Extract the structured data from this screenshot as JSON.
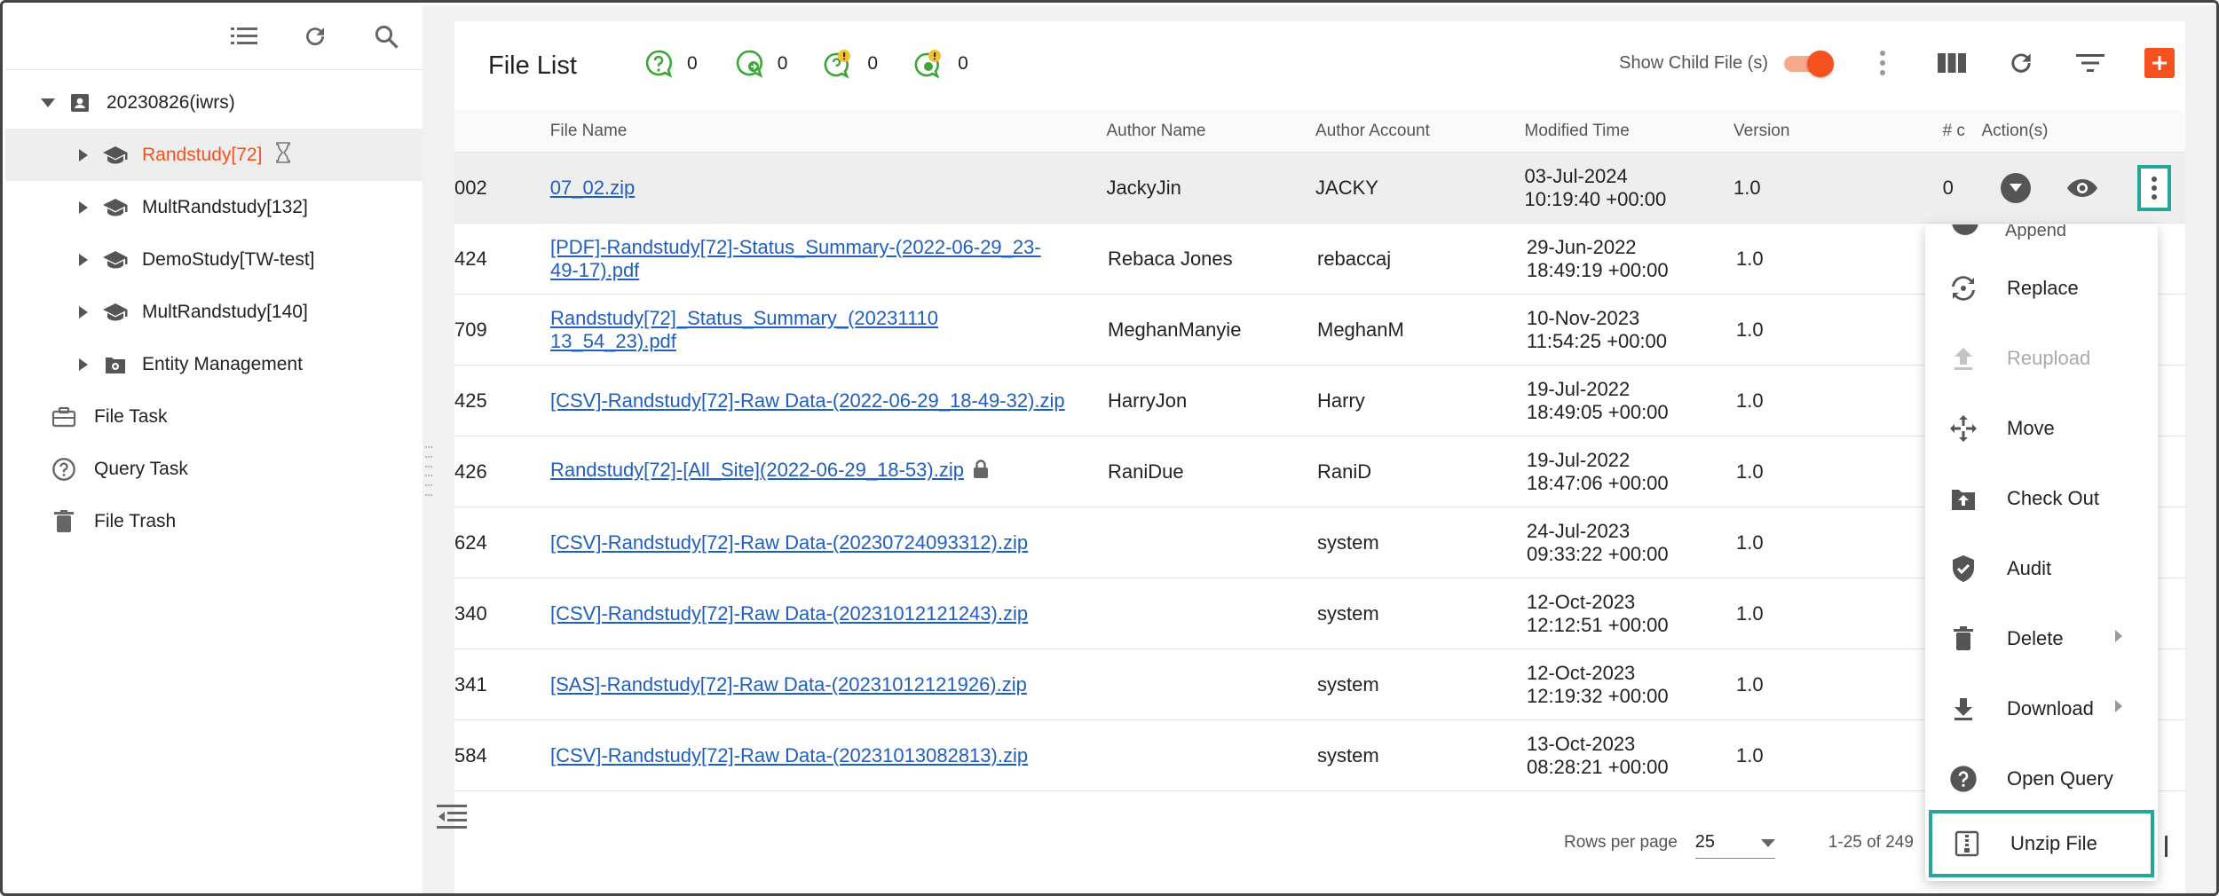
{
  "sidebar": {
    "toolbar": {
      "list_icon": "list-icon",
      "refresh_icon": "refresh-icon",
      "search_icon": "search-icon"
    },
    "root": {
      "label": "20230826(iwrs)"
    },
    "studies": [
      {
        "label": "Randstudy[72]",
        "active": true
      },
      {
        "label": "MultRandstudy[132]"
      },
      {
        "label": "DemoStudy[TW-test]"
      },
      {
        "label": "MultRandstudy[140]"
      },
      {
        "label": "Entity Management"
      }
    ],
    "tasks": [
      {
        "label": "File Task"
      },
      {
        "label": "Query Task"
      },
      {
        "label": "File Trash"
      }
    ]
  },
  "header": {
    "title": "File List",
    "counters": [
      {
        "icon": "query-open-icon",
        "value": "0"
      },
      {
        "icon": "query-reply-icon",
        "value": "0"
      },
      {
        "icon": "query-warning-icon",
        "value": "0"
      },
      {
        "icon": "query-alert-icon",
        "value": "0"
      }
    ],
    "show_child_label": "Show Child File (s)",
    "show_child_on": true
  },
  "table": {
    "columns": {
      "name": "File Name",
      "author": "Author Name",
      "account": "Author Account",
      "modified": "Modified Time",
      "version": "Version",
      "count": "# c",
      "actions": "Action(s)"
    },
    "rows": [
      {
        "id": "002",
        "name": "07_02.zip",
        "author": "JackyJin",
        "account": "JACKY",
        "date": "03-Jul-2024",
        "time": "10:19:40 +00:00",
        "version": "1.0",
        "count": "0"
      },
      {
        "id": "424",
        "name_line1": "[PDF]-Randstudy[72]-Status_Summary-(2022-06-29_23-",
        "name_line2": "49-17).pdf",
        "author": "Rebaca Jones",
        "account": "rebaccaj",
        "date": "29-Jun-2022",
        "time": "18:49:19 +00:00",
        "version": "1.0"
      },
      {
        "id": "709",
        "name_line1": "Randstudy[72]_Status_Summary_(20231110",
        "name_line2": "13_54_23).pdf",
        "author": "MeghanManyie",
        "account": "MeghanM",
        "date": "10-Nov-2023",
        "time": "11:54:25 +00:00",
        "version": "1.0"
      },
      {
        "id": "425",
        "name": "[CSV]-Randstudy[72]-Raw Data-(2022-06-29_18-49-32).zip",
        "author": "HarryJon",
        "account": "Harry",
        "date": "19-Jul-2022",
        "time": "18:49:05 +00:00",
        "version": "1.0"
      },
      {
        "id": "426",
        "name": "Randstudy[72]-[All_Site](2022-06-29_18-53).zip",
        "author": "RaniDue",
        "account": "RaniD",
        "date": "19-Jul-2022",
        "time": "18:47:06 +00:00",
        "version": "1.0"
      },
      {
        "id": "624",
        "name": "[CSV]-Randstudy[72]-Raw Data-(20230724093312).zip",
        "author": "",
        "account": "system",
        "date": "24-Jul-2023",
        "time": "09:33:22 +00:00",
        "version": "1.0"
      },
      {
        "id": "340",
        "name": "[CSV]-Randstudy[72]-Raw Data-(20231012121243).zip",
        "author": "",
        "account": "system",
        "date": "12-Oct-2023",
        "time": "12:12:51 +00:00",
        "version": "1.0"
      },
      {
        "id": "341",
        "name": "[SAS]-Randstudy[72]-Raw Data-(20231012121926).zip",
        "author": "",
        "account": "system",
        "date": "12-Oct-2023",
        "time": "12:19:32 +00:00",
        "version": "1.0"
      },
      {
        "id": "584",
        "name": "[CSV]-Randstudy[72]-Raw Data-(20231013082813).zip",
        "author": "",
        "account": "system",
        "date": "13-Oct-2023",
        "time": "08:28:21 +00:00",
        "version": "1.0"
      }
    ]
  },
  "pagination": {
    "rows_per_page_label": "Rows per page",
    "rows_per_page": "25",
    "range": "1-25 of 249"
  },
  "context_menu": {
    "partial_label": "Append",
    "items": [
      {
        "label": "Replace",
        "icon": "replace-icon"
      },
      {
        "label": "Reupload",
        "icon": "upload-icon",
        "disabled": true
      },
      {
        "label": "Move",
        "icon": "move-icon"
      },
      {
        "label": "Check Out",
        "icon": "check-out-icon"
      },
      {
        "label": "Audit",
        "icon": "shield-check-icon"
      },
      {
        "label": "Delete",
        "icon": "trash-icon",
        "submenu": true
      },
      {
        "label": "Download",
        "icon": "download-icon",
        "submenu": true
      },
      {
        "label": "Open Query",
        "icon": "help-circle-icon"
      },
      {
        "label": "Unzip File",
        "icon": "zip-file-icon",
        "highlighted": true
      }
    ]
  },
  "colors": {
    "accent": "#f4511e",
    "link": "#1f5fbf",
    "highlight_box": "#26a69a"
  }
}
